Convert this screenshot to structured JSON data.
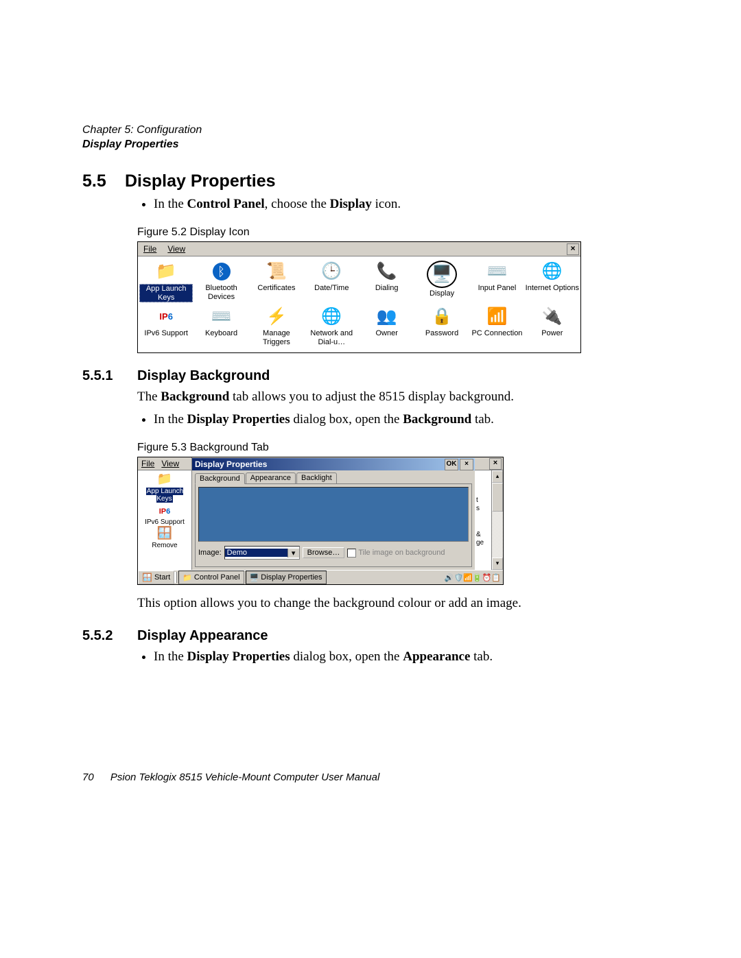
{
  "header": {
    "chapter": "Chapter 5: Configuration",
    "section": "Display Properties"
  },
  "s55": {
    "num": "5.5",
    "title": "Display Properties",
    "bullet1_pre": "In the ",
    "bullet1_b1": "Control Panel",
    "bullet1_mid": ", choose the ",
    "bullet1_b2": "Display",
    "bullet1_post": " icon."
  },
  "fig52": {
    "caption": "Figure 5.2  Display Icon"
  },
  "cp": {
    "menu": {
      "file": "File",
      "view": "View"
    },
    "close": "×",
    "row1": [
      {
        "label": "App Launch Keys",
        "icon": "📁",
        "sel": true
      },
      {
        "label": "Bluetooth Devices",
        "icon": "ᛒ"
      },
      {
        "label": "Certificates",
        "icon": "📜"
      },
      {
        "label": "Date/Time",
        "icon": "🕒"
      },
      {
        "label": "Dialing",
        "icon": "📞"
      },
      {
        "label": "Display",
        "icon": "🖥️",
        "hl": true
      },
      {
        "label": "Input Panel",
        "icon": "⌨️"
      },
      {
        "label": "Internet Options",
        "icon": "🌐"
      }
    ],
    "row2": [
      {
        "label": "IPv6 Support",
        "icon": "IP6"
      },
      {
        "label": "Keyboard",
        "icon": "⌨️"
      },
      {
        "label": "Manage Triggers",
        "icon": "⚡"
      },
      {
        "label": "Network and Dial-u…",
        "icon": "🌐"
      },
      {
        "label": "Owner",
        "icon": "👥"
      },
      {
        "label": "Password",
        "icon": "🔒"
      },
      {
        "label": "PC Connection",
        "icon": "📶"
      },
      {
        "label": "Power",
        "icon": "🔌"
      }
    ]
  },
  "s551": {
    "num": "5.5.1",
    "title": "Display Background",
    "para_pre": "The ",
    "para_b": "Background",
    "para_post": " tab allows you to adjust the 8515 display background.",
    "bullet_pre": "In the ",
    "bullet_b1": "Display Properties",
    "bullet_mid": " dialog box, open the ",
    "bullet_b2": "Background",
    "bullet_post": " tab."
  },
  "fig53": {
    "caption": "Figure 5.3  Background Tab"
  },
  "dp": {
    "left_menu": {
      "file": "File",
      "view": "View"
    },
    "left_items": [
      {
        "label": "App Launch Keys",
        "icon": "📁",
        "sel": true
      },
      {
        "label": "IPv6 Support",
        "icon": "IP6"
      },
      {
        "label": "Remove",
        "icon": "🪟"
      }
    ],
    "title": "Display Properties",
    "ok": "OK",
    "close": "×",
    "outer_close": "×",
    "tabs": [
      "Background",
      "Appearance",
      "Backlight"
    ],
    "image_label": "Image:",
    "image_value": "Demo",
    "browse": "Browse…",
    "tile": "Tile image on background",
    "gutter": [
      "t",
      "s",
      "&",
      "ge"
    ],
    "taskbar": {
      "start": "Start",
      "task1": "Control Panel",
      "task2": "Display Properties",
      "tray": "🔊🛡️📶🔋⏰📋"
    }
  },
  "after_fig53": "This option allows you to change the background colour or add an image.",
  "s552": {
    "num": "5.5.2",
    "title": "Display Appearance",
    "bullet_pre": "In the ",
    "bullet_b1": "Display Properties",
    "bullet_mid": " dialog box, open the ",
    "bullet_b2": "Appearance",
    "bullet_post": " tab."
  },
  "footer": {
    "page": "70",
    "text": "Psion Teklogix 8515 Vehicle-Mount Computer User Manual"
  }
}
